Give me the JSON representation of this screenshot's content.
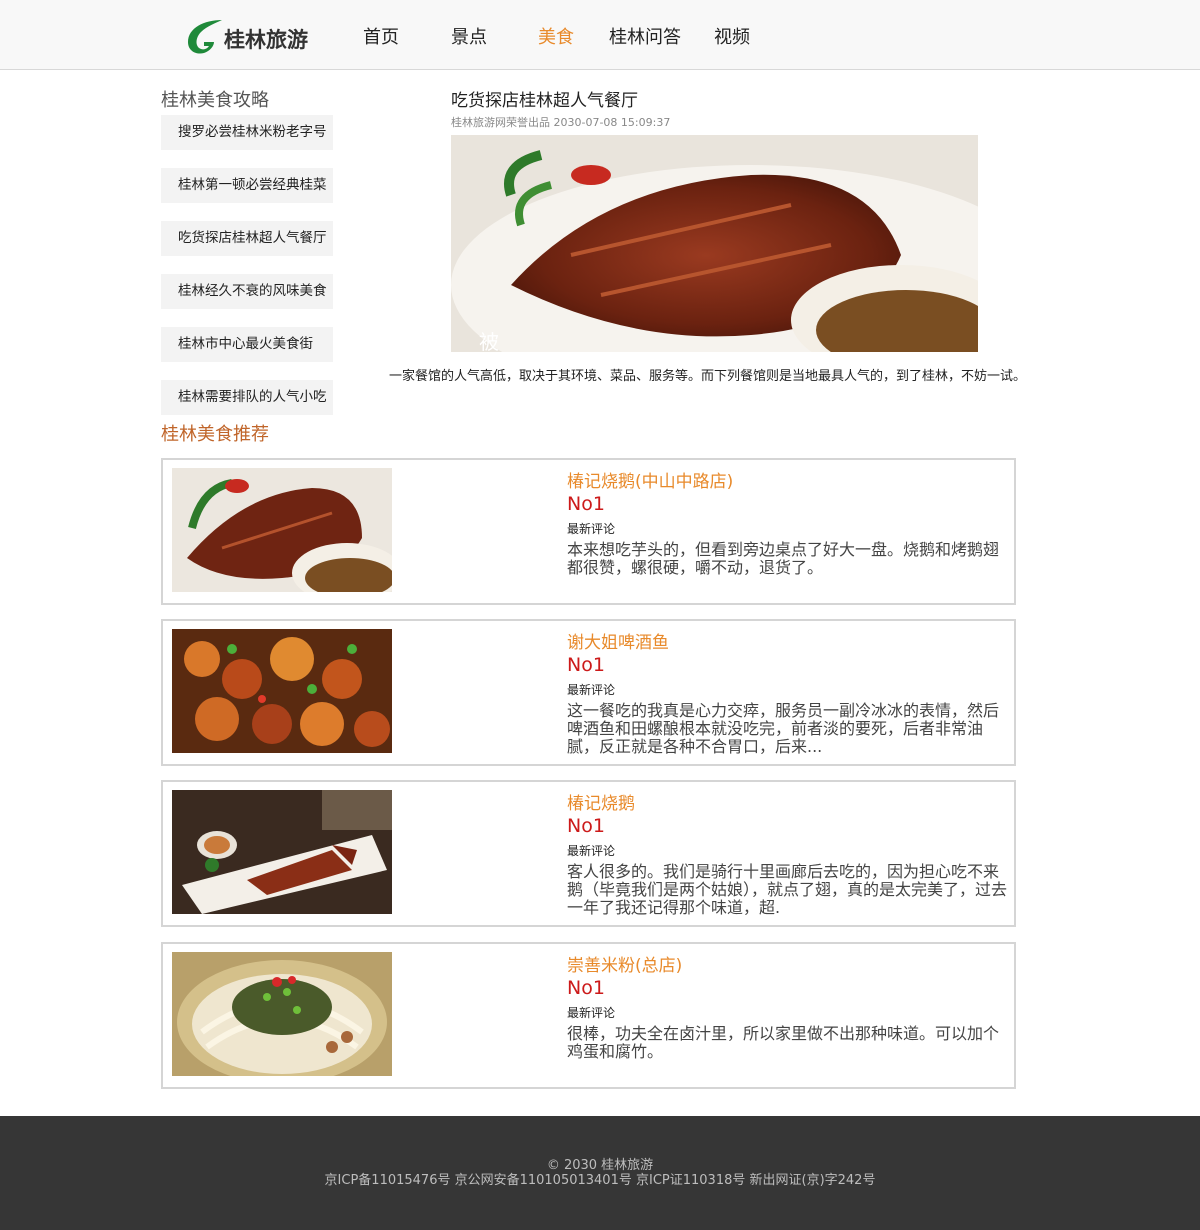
{
  "header": {
    "logo_text": "桂林旅游",
    "logo_icon": "green-leaf-logo-icon",
    "nav": [
      {
        "label": "首页",
        "active": false
      },
      {
        "label": "景点",
        "active": false
      },
      {
        "label": "美食",
        "active": true
      },
      {
        "label": "桂林问答",
        "active": false
      },
      {
        "label": "视频",
        "active": false
      }
    ]
  },
  "sidebar": {
    "title": "桂林美食攻略",
    "items": [
      "搜罗必尝桂林米粉老字号",
      "桂林第一顿必尝经典桂菜",
      "吃货探店桂林超人气餐厅",
      "桂林经久不衰的风味美食",
      "桂林市中心最火美食街",
      "桂林需要排队的人气小吃"
    ]
  },
  "article": {
    "title": "吃货探店桂林超人气餐厅",
    "meta": "桂林旅游网荣誉出品 2030-07-08 15:09:37",
    "image": "roast-goose-photo",
    "text": "一家餐馆的人气高低，取决于其环境、菜品、服务等。而下列餐馆则是当地最具人气的，到了桂林，不妨一试。"
  },
  "recommend": {
    "title": "桂林美食推荐",
    "items": [
      {
        "name": "椿记烧鹅(中山中路店)",
        "rank": "No1",
        "label": "最新评论",
        "comment": "本来想吃芋头的，但看到旁边桌点了好大一盘。烧鹅和烤鹅翅都很赞，螺很硬，嚼不动，退货了。",
        "image": "roast-goose-photo"
      },
      {
        "name": "谢大姐啤酒鱼",
        "rank": "No1",
        "label": "最新评论",
        "comment": "这一餐吃的我真是心力交瘁，服务员一副冷冰冰的表情，然后啤酒鱼和田螺酿根本就没吃完，前者淡的要死，后者非常油腻，反正就是各种不合胃口，后来...",
        "image": "beer-fish-photo"
      },
      {
        "name": "椿记烧鹅",
        "rank": "No1",
        "label": "最新评论",
        "comment": "客人很多的。我们是骑行十里画廊后去吃的，因为担心吃不来鹅（毕竟我们是两个姑娘），就点了翅，真的是太完美了，过去一年了我还记得那个味道，超.",
        "image": "sliced-goose-plate-photo"
      },
      {
        "name": "崇善米粉(总店)",
        "rank": "No1",
        "label": "最新评论",
        "comment": "很棒，功夫全在卤汁里，所以家里做不出那种味道。可以加个鸡蛋和腐竹。",
        "image": "rice-noodle-photo"
      }
    ]
  },
  "footer": {
    "line1": "© 2030 桂林旅游",
    "line2": "京ICP备11015476号 京公网安备110105013401号 京ICP证110318号 新出网证(京)字242号"
  },
  "colors": {
    "accent": "#e88a2b",
    "rank_red": "#cc1a1a",
    "logo_green": "#1f8a3a",
    "footer_bg": "#363636"
  }
}
